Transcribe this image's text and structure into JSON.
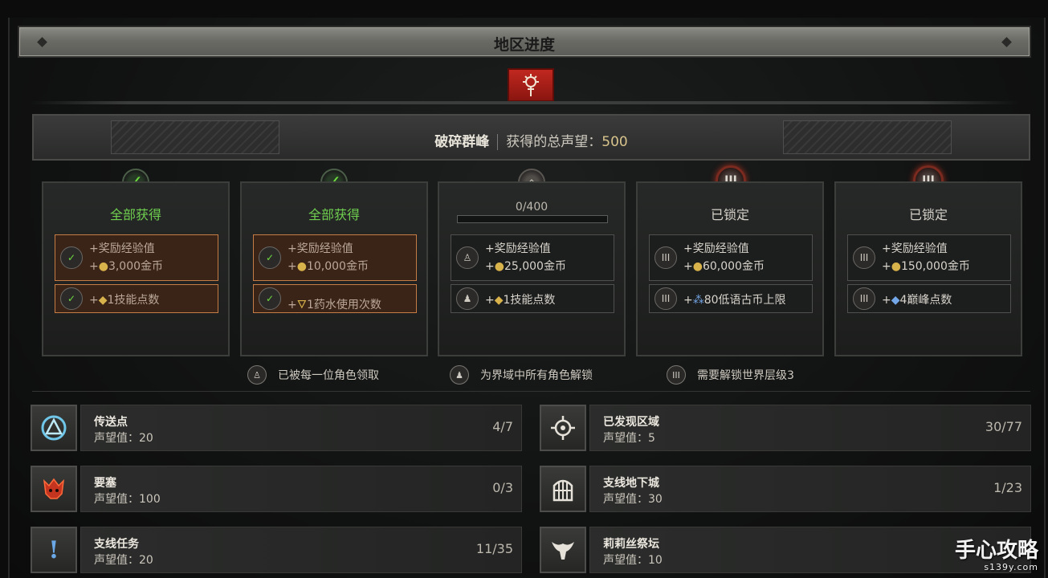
{
  "window": {
    "title": "地区进度"
  },
  "region": {
    "name": "破碎群峰",
    "renown_label": "获得的总声望：",
    "renown_value": "500"
  },
  "tiers": [
    {
      "status": "全部获得",
      "state": "claimed",
      "r1a": "+奖励经验值",
      "r1b_prefix": "+",
      "r1b_value": "3,000金币",
      "r2_prefix": "+",
      "r2_value": "1技能点数"
    },
    {
      "status": "全部获得",
      "state": "claimed",
      "r1a": "+奖励经验值",
      "r1b_prefix": "+",
      "r1b_value": "10,000金币",
      "r2_prefix": "+",
      "r2_value": "1药水使用次数"
    },
    {
      "progress_text": "0/400",
      "progress": 0.0,
      "state": "progress",
      "r1a": "+奖励经验值",
      "r1b_prefix": "+",
      "r1b_value": "25,000金币",
      "r2_prefix": "+",
      "r2_value": "1技能点数"
    },
    {
      "status": "已锁定",
      "state": "locked",
      "r1a": "+奖励经验值",
      "r1b_prefix": "+",
      "r1b_value": "60,000金币",
      "r2_prefix": "+",
      "r2_value": "80低语古币上限"
    },
    {
      "status": "已锁定",
      "state": "locked",
      "r1a": "+奖励经验值",
      "r1b_prefix": "+",
      "r1b_value": "150,000金币",
      "r2_prefix": "+",
      "r2_value": "4巅峰点数"
    }
  ],
  "legend": [
    {
      "icon": "single-character-icon",
      "text": "已被每一位角色领取"
    },
    {
      "icon": "all-characters-icon",
      "text": "为界域中所有角色解锁"
    },
    {
      "icon": "world-tier-icon",
      "text": "需要解锁世界层级3"
    }
  ],
  "stats": {
    "waypoints": {
      "name": "传送点",
      "rep": "声望值：20",
      "count": "4/7"
    },
    "areas": {
      "name": "已发现区域",
      "rep": "声望值：5",
      "count": "30/77"
    },
    "strongholds": {
      "name": "要塞",
      "rep": "声望值：100",
      "count": "0/3"
    },
    "dungeons": {
      "name": "支线地下城",
      "rep": "声望值：30",
      "count": "1/23"
    },
    "quests": {
      "name": "支线任务",
      "rep": "声望值：20",
      "count": "11/35"
    },
    "altars": {
      "name": "莉莉丝祭坛",
      "rep": "声望值：10",
      "count": ""
    }
  },
  "watermark": {
    "main": "手心攻略",
    "sub": "s139y.com"
  },
  "colors": {
    "accent_gold": "#d8c48c",
    "claimed_green": "#6fcf4f",
    "claimed_border": "#c67c45",
    "emblem_red": "#c0281f"
  }
}
